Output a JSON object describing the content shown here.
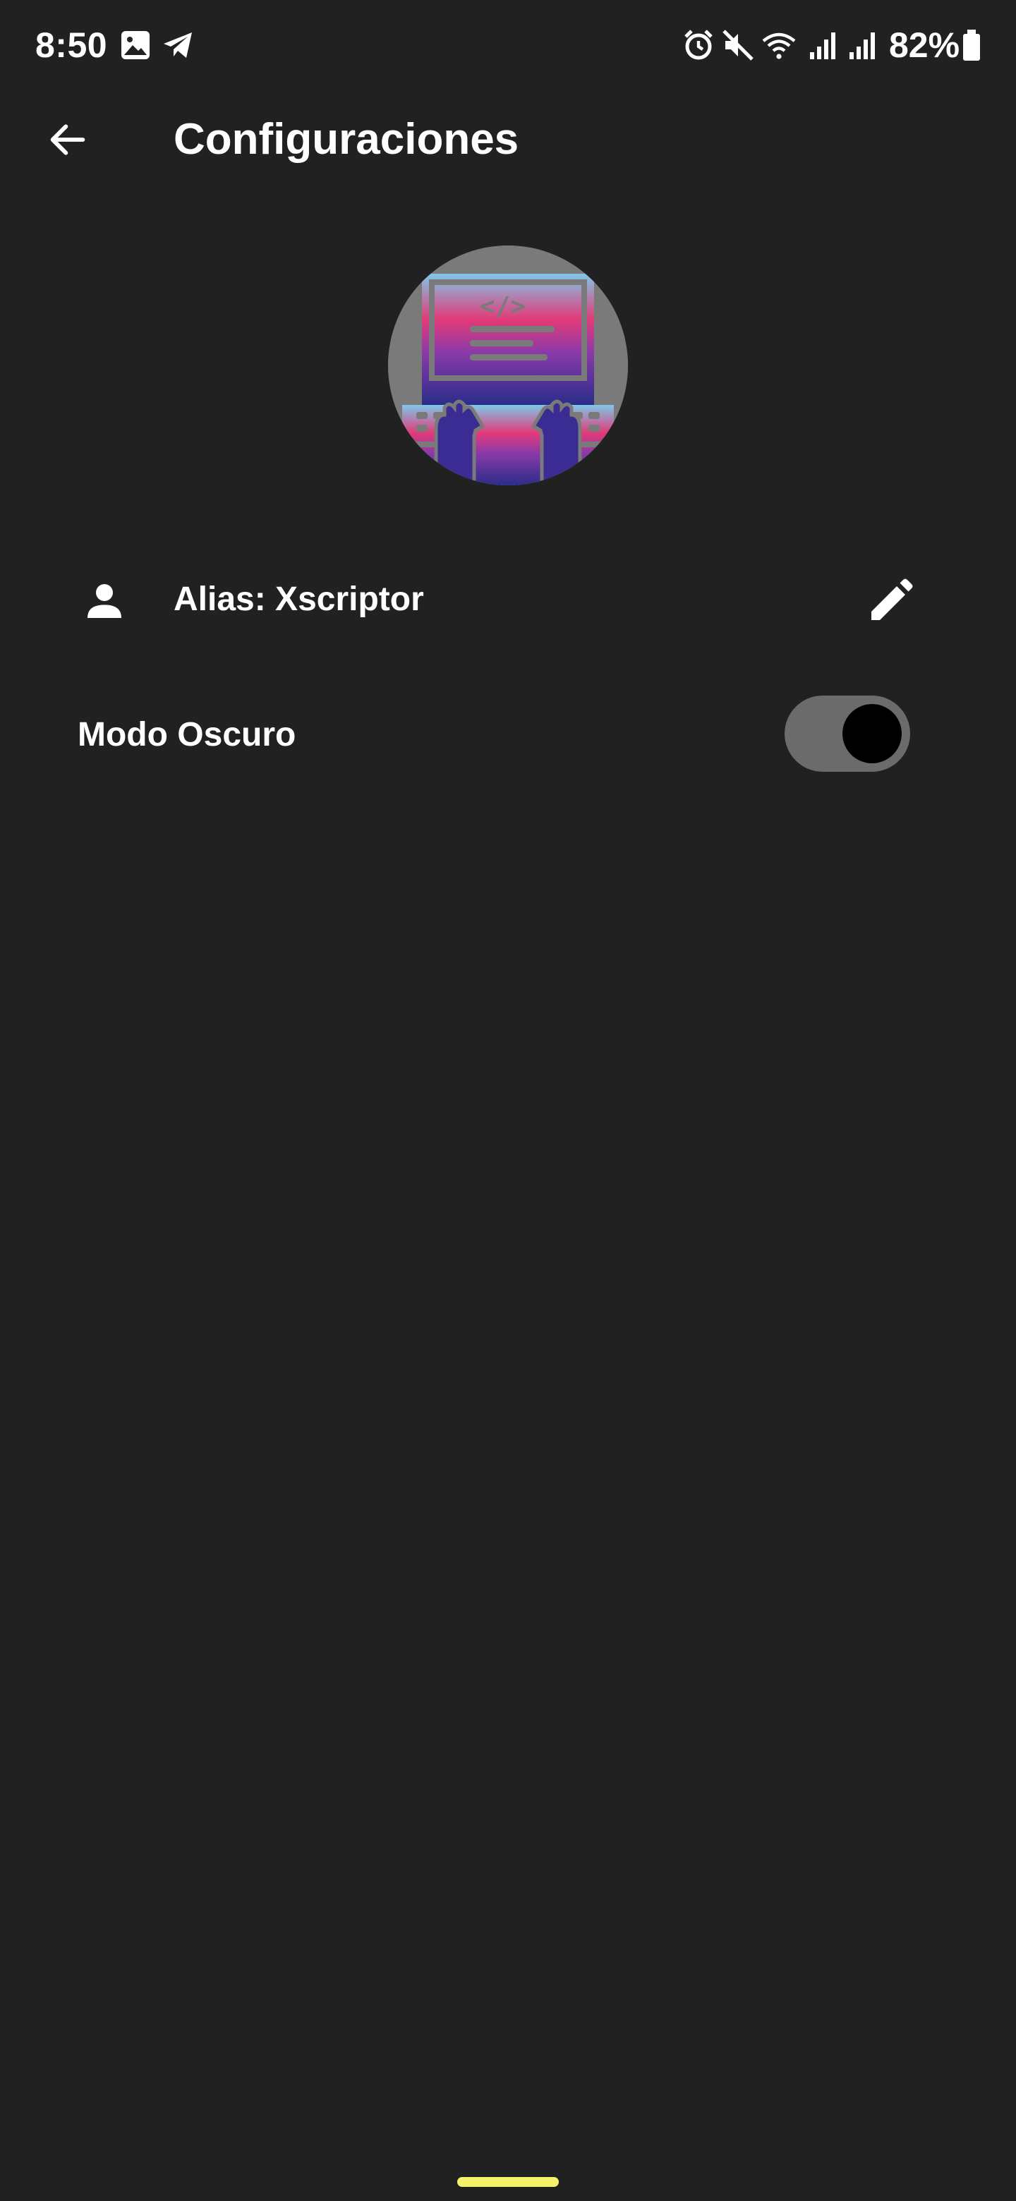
{
  "status_bar": {
    "time": "8:50",
    "battery": "82%",
    "left_icons": [
      "gallery-icon",
      "telegram-icon"
    ],
    "right_icons": [
      "alarm-icon",
      "mute-icon",
      "wifi-icon",
      "signal-icon",
      "signal-icon",
      "battery-icon"
    ]
  },
  "app_bar": {
    "title": "Configuraciones",
    "back_icon": "arrow-back-icon"
  },
  "profile": {
    "alias": "Alias: Xscriptor",
    "person_icon": "person-icon",
    "edit_icon": "pencil-icon"
  },
  "settings": {
    "dark_mode_label": "Modo Oscuro",
    "dark_mode_enabled": true
  },
  "colors": {
    "background": "#212121",
    "text": "#ffffff",
    "toggle_track": "#6b6b6b",
    "toggle_knob": "#000000",
    "home_indicator": "#f7f26a",
    "avatar_bg": "#7a7a7a"
  }
}
